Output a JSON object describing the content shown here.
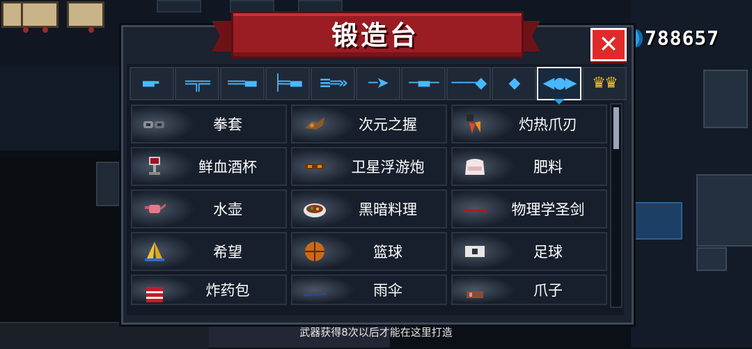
{
  "window": {
    "title": "锻造台",
    "close_label": "✕"
  },
  "currency": {
    "icon": "gem-icon",
    "amount": "788657",
    "color": "#2c9de8"
  },
  "tabs": [
    {
      "icon": "pistol-icon",
      "glyph": "▬╸",
      "active": false
    },
    {
      "icon": "rifle-icon",
      "glyph": "═╦═",
      "active": false
    },
    {
      "icon": "shotgun-icon",
      "glyph": "══▬",
      "active": false
    },
    {
      "icon": "launcher-icon",
      "glyph": "╞═▬",
      "active": false
    },
    {
      "icon": "laser-gun-icon",
      "glyph": "≡═»",
      "active": false
    },
    {
      "icon": "bow-icon",
      "glyph": "─➤",
      "active": false
    },
    {
      "icon": "sword-icon",
      "glyph": "─▬─",
      "active": false
    },
    {
      "icon": "spear-icon",
      "glyph": "───◆",
      "active": false
    },
    {
      "icon": "shuriken-icon",
      "glyph": "◆",
      "active": false
    },
    {
      "icon": "fish-icon",
      "glyph": "◀●▶",
      "active": true
    },
    {
      "icon": "crown-icon",
      "glyph": "♛♛",
      "active": false
    }
  ],
  "items": [
    {
      "name": "拳套",
      "icon": "knuckles-icon"
    },
    {
      "name": "次元之握",
      "icon": "dimension-grip-icon"
    },
    {
      "name": "灼热爪刃",
      "icon": "scorching-claw-icon"
    },
    {
      "name": "鲜血酒杯",
      "icon": "blood-goblet-icon"
    },
    {
      "name": "卫星浮游炮",
      "icon": "satellite-drone-icon"
    },
    {
      "name": "肥料",
      "icon": "fertilizer-bag-icon"
    },
    {
      "name": "水壶",
      "icon": "watering-can-icon"
    },
    {
      "name": "黑暗料理",
      "icon": "dark-cuisine-icon"
    },
    {
      "name": "物理学圣剑",
      "icon": "crowbar-icon"
    },
    {
      "name": "希望",
      "icon": "praying-hands-icon"
    },
    {
      "name": "篮球",
      "icon": "basketball-icon"
    },
    {
      "name": "足球",
      "icon": "soccer-ball-icon"
    },
    {
      "name": "炸药包",
      "icon": "dynamite-pack-icon"
    },
    {
      "name": "雨伞",
      "icon": "umbrella-icon"
    },
    {
      "name": "爪子",
      "icon": "claw-icon"
    }
  ],
  "footer": {
    "notice": "武器获得8次以后才能在这里打造"
  },
  "scrollbar": {
    "position": 0.0
  }
}
